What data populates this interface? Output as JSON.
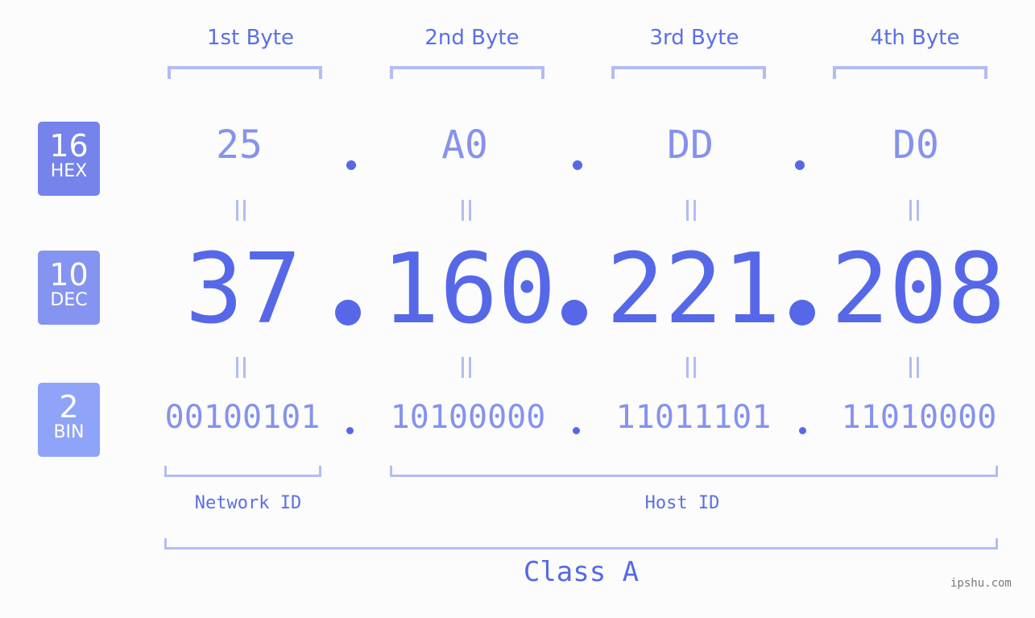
{
  "byte_headers": [
    "1st Byte",
    "2nd Byte",
    "3rd Byte",
    "4th Byte"
  ],
  "badges": {
    "hex": {
      "base": "16",
      "label": "HEX",
      "color": "#7583ea"
    },
    "dec": {
      "base": "10",
      "label": "DEC",
      "color": "#8594f0"
    },
    "bin": {
      "base": "2",
      "label": "BIN",
      "color": "#8fa4f8"
    }
  },
  "ip": {
    "hex": [
      "25",
      "A0",
      "DD",
      "D0"
    ],
    "dec": [
      "37",
      "160",
      "221",
      "208"
    ],
    "bin": [
      "00100101",
      "10100000",
      "11011101",
      "11010000"
    ]
  },
  "segments": {
    "network_id": "Network ID",
    "host_id": "Host ID",
    "class": "Class A"
  },
  "watermark": "ipshu.com",
  "colors": {
    "primary": "#5668e8",
    "light": "#8592ee",
    "bracket": "#b3bcf5"
  }
}
